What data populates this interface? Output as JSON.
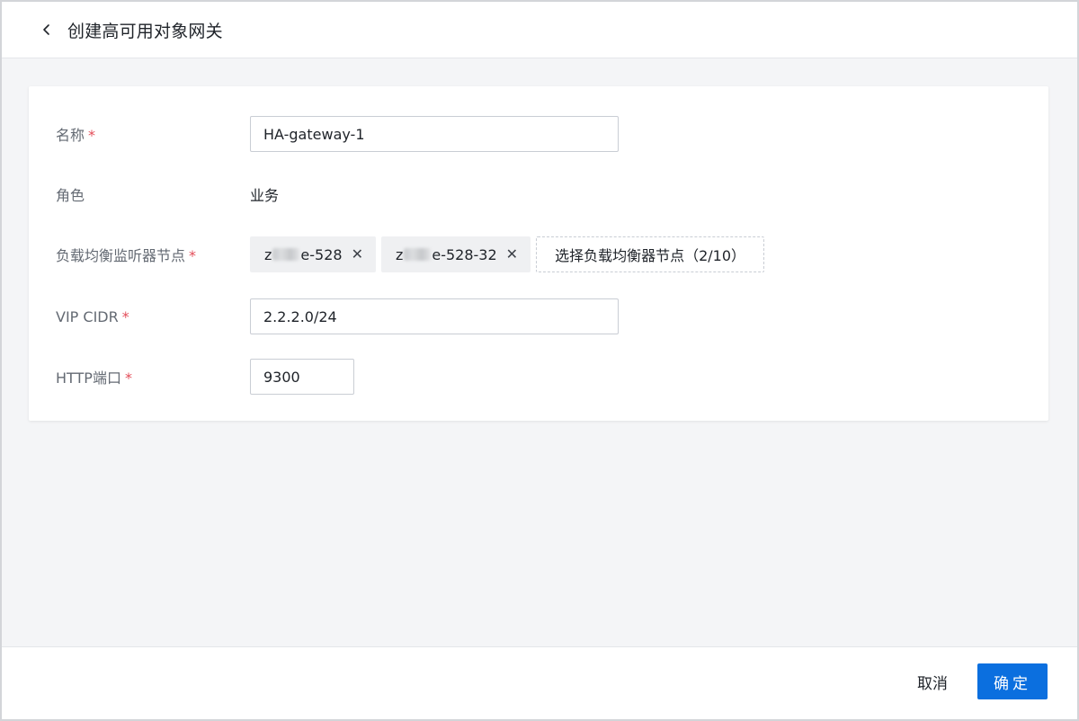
{
  "header": {
    "title": "创建高可用对象网关",
    "back_icon": "chevron-left-icon"
  },
  "form": {
    "name": {
      "label": "名称",
      "required_mark": "*",
      "value": "HA-gateway-1"
    },
    "role": {
      "label": "角色",
      "value": "业务"
    },
    "lb_nodes": {
      "label": "负载均衡监听器节点",
      "required_mark": "*",
      "tags": [
        {
          "prefix": "z",
          "suffix": "e-528",
          "close": "✕"
        },
        {
          "prefix": "z",
          "suffix": "e-528-32",
          "close": "✕"
        }
      ],
      "select_label": "选择负载均衡器节点（2/10）"
    },
    "vip_cidr": {
      "label": "VIP CIDR",
      "required_mark": "*",
      "value": "2.2.2.0/24"
    },
    "http_port": {
      "label": "HTTP端口",
      "required_mark": "*",
      "value": "9300"
    }
  },
  "footer": {
    "cancel_label": "取消",
    "ok_label": "确定"
  },
  "colors": {
    "primary": "#0b6fdf",
    "required": "#e34d59",
    "background": "#f4f5f7"
  }
}
